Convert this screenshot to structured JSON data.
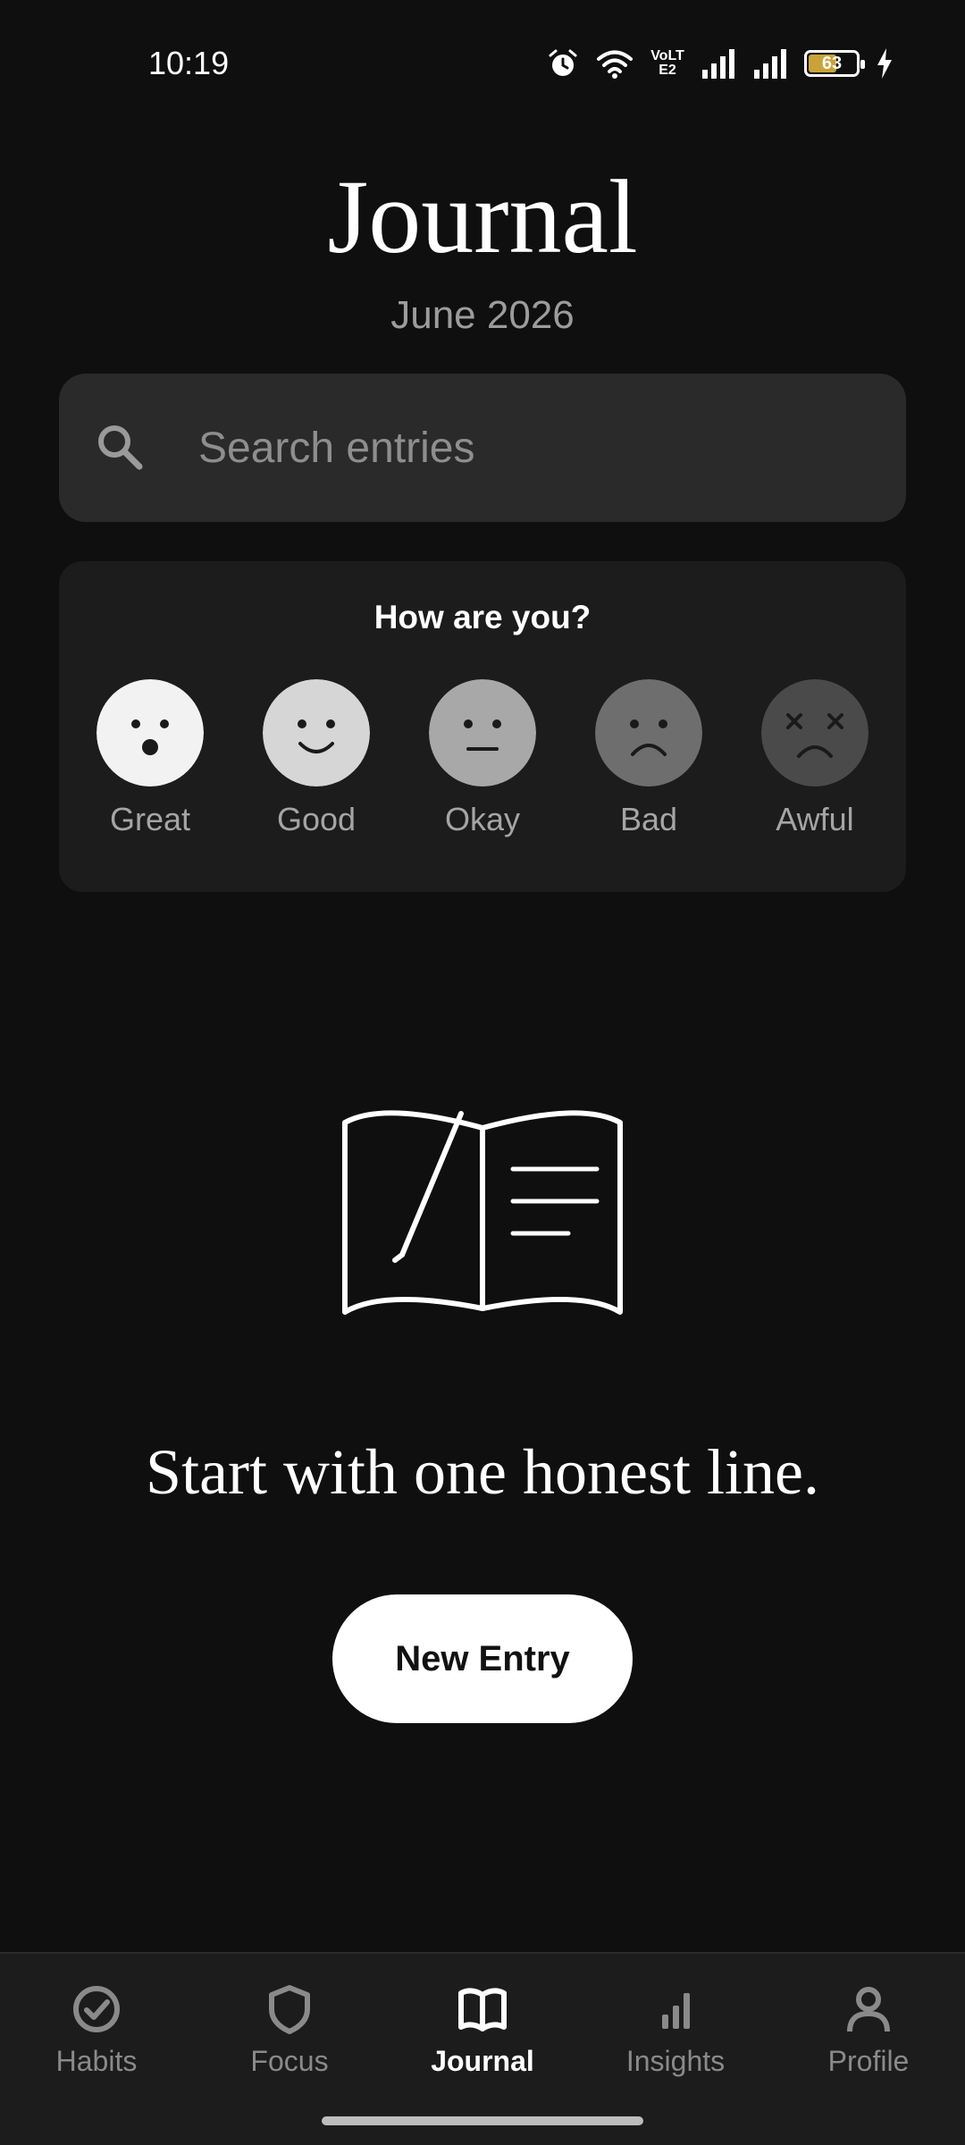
{
  "status_bar": {
    "time": "10:19",
    "network_label": "VoLTE2",
    "battery_level": "63"
  },
  "header": {
    "title": "Journal",
    "subtitle": "June 2026"
  },
  "search": {
    "placeholder": "Search entries",
    "value": ""
  },
  "mood": {
    "title": "How are you?",
    "options": [
      {
        "label": "Great",
        "face_color": "#f2f2f2",
        "icon": "surprised-face-icon"
      },
      {
        "label": "Good",
        "face_color": "#d6d6d6",
        "icon": "smile-face-icon"
      },
      {
        "label": "Okay",
        "face_color": "#a8a8a8",
        "icon": "neutral-face-icon"
      },
      {
        "label": "Bad",
        "face_color": "#6e6e6e",
        "icon": "sad-face-icon"
      },
      {
        "label": "Awful",
        "face_color": "#4a4a4a",
        "icon": "dead-face-icon"
      }
    ]
  },
  "empty_state": {
    "icon": "open-book-pen-icon",
    "message": "Start with one honest line.",
    "button_label": "New Entry"
  },
  "nav": {
    "active": "Journal",
    "items": [
      {
        "label": "Habits",
        "icon": "check-circle-icon"
      },
      {
        "label": "Focus",
        "icon": "shield-icon"
      },
      {
        "label": "Journal",
        "icon": "book-icon"
      },
      {
        "label": "Insights",
        "icon": "bar-chart-icon"
      },
      {
        "label": "Profile",
        "icon": "person-icon"
      }
    ]
  },
  "colors": {
    "background": "#0f0f0f",
    "card": "#1c1c1c",
    "search_bg": "#2a2a2a",
    "muted_text": "#8e8e8e",
    "battery": "#c9a23a"
  }
}
